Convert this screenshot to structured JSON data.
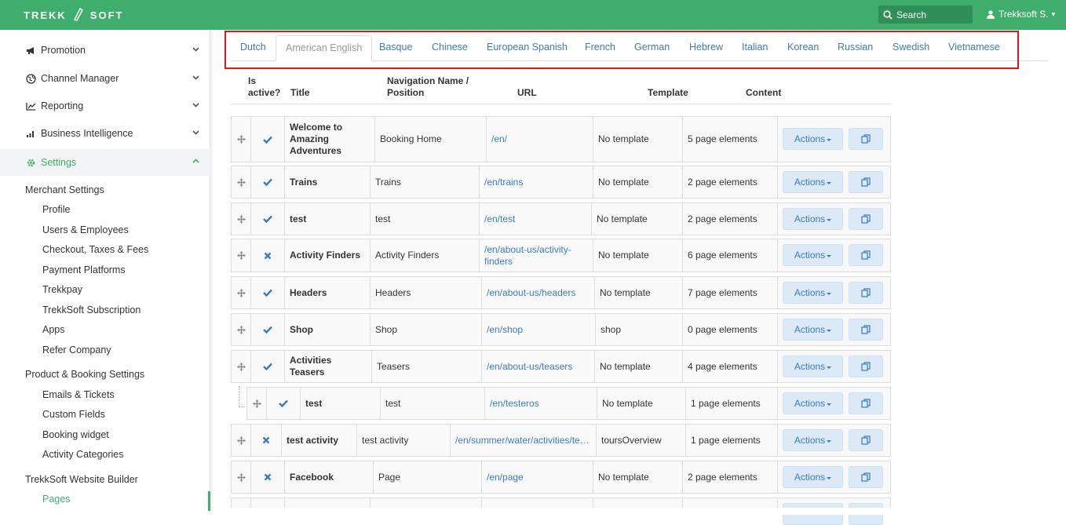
{
  "brand": {
    "left": "TREKK",
    "right": "SOFT"
  },
  "header": {
    "search_label": "Search",
    "user_label": "Trekksoft S."
  },
  "sidebar": {
    "items": [
      {
        "label": "Promotion",
        "icon": "megaphone-icon"
      },
      {
        "label": "Channel Manager",
        "icon": "globe-icon"
      },
      {
        "label": "Reporting",
        "icon": "line-chart-icon"
      },
      {
        "label": "Business Intelligence",
        "icon": "bar-chart-icon"
      },
      {
        "label": "Settings",
        "icon": "gear-icon"
      }
    ],
    "groups": [
      {
        "heading": "Merchant Settings",
        "items": [
          "Profile",
          "Users & Employees",
          "Checkout, Taxes & Fees",
          "Payment Platforms",
          "Trekkpay",
          "TrekkSoft Subscription",
          "Apps",
          "Refer Company"
        ]
      },
      {
        "heading": "Product & Booking Settings",
        "items": [
          "Emails & Tickets",
          "Custom Fields",
          "Booking widget",
          "Activity Categories"
        ]
      },
      {
        "heading": "TrekkSoft Website Builder",
        "items": [
          "Pages"
        ]
      }
    ]
  },
  "tabs": [
    "Dutch",
    "American English",
    "Basque",
    "Chinese",
    "European Spanish",
    "French",
    "German",
    "Hebrew",
    "Italian",
    "Korean",
    "Russian",
    "Swedish",
    "Vietnamese"
  ],
  "active_tab": "American English",
  "table": {
    "columns": {
      "active": "Is active?",
      "title": "Title",
      "nav": "Navigation Name / Position",
      "url": "URL",
      "template": "Template",
      "content": "Content"
    },
    "actions_label": "Actions",
    "rows": [
      {
        "active": true,
        "title": "Welcome to Amazing Adventures",
        "nav": "Booking Home",
        "url": "/en/",
        "template": "No template",
        "content": "5 page elements"
      },
      {
        "active": true,
        "title": "Trains",
        "nav": "Trains",
        "url": "/en/trains",
        "template": "No template",
        "content": "2 page elements"
      },
      {
        "active": true,
        "title": "test",
        "nav": "test",
        "url": "/en/test",
        "template": "No template",
        "content": "2 page elements"
      },
      {
        "active": false,
        "title": "Activity Finders",
        "nav": "Activity Finders",
        "url": "/en/about-us/activity-finders",
        "template": "No template",
        "content": "6 page elements"
      },
      {
        "active": true,
        "title": "Headers",
        "nav": "Headers",
        "url": "/en/about-us/headers",
        "template": "No template",
        "content": "7 page elements"
      },
      {
        "active": true,
        "title": "Shop",
        "nav": "Shop",
        "url": "/en/shop",
        "template": "shop",
        "content": "0 page elements"
      },
      {
        "active": true,
        "title": "Activities Teasers",
        "nav": "Teasers",
        "url": "/en/about-us/teasers",
        "template": "No template",
        "content": "4 page elements"
      },
      {
        "active": true,
        "title": "test",
        "nav": "test",
        "url": "/en/testeros",
        "template": "No template",
        "content": "1 page elements"
      },
      {
        "active": false,
        "title": "test activity",
        "nav": "test activity",
        "url": "/en/summer/water/activities/te…",
        "template": "toursOverview",
        "content": "1 page elements"
      },
      {
        "active": false,
        "title": "Facebook",
        "nav": "Page",
        "url": "/en/page",
        "template": "No template",
        "content": "2 page elements"
      }
    ]
  },
  "colors": {
    "brand_green": "#3fad6b",
    "link_blue": "#3a7bbf",
    "highlight_red": "#e0141e"
  }
}
